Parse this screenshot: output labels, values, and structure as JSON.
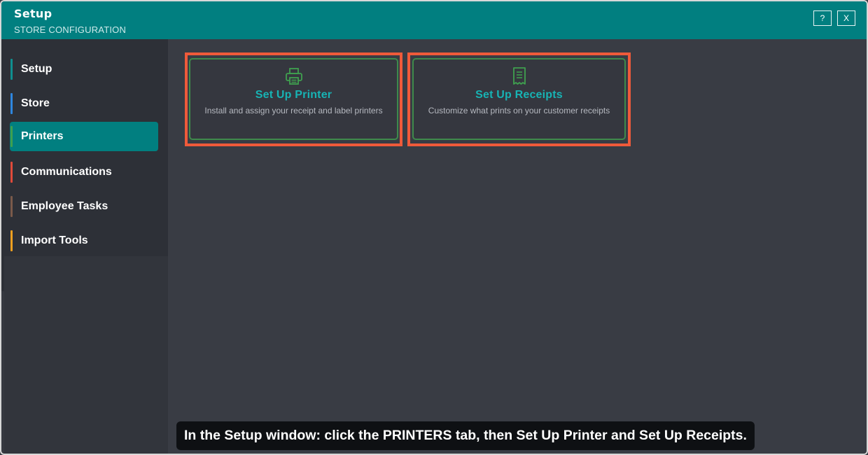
{
  "window": {
    "title": "Setup",
    "subtitle": "STORE CONFIGURATION",
    "help_label": "?",
    "close_label": "X"
  },
  "sidebar": {
    "items": [
      {
        "label": "Setup",
        "accent": "#0f8f8f",
        "active": false
      },
      {
        "label": "Store",
        "accent": "#2e86de",
        "active": false
      },
      {
        "label": "Printers",
        "accent": "#3fa04f",
        "active": true
      },
      {
        "label": "Communications",
        "accent": "#e04a3a",
        "active": false
      },
      {
        "label": "Employee Tasks",
        "accent": "#7a5a4a",
        "active": false
      },
      {
        "label": "Import Tools",
        "accent": "#f0a020",
        "active": false
      }
    ]
  },
  "cards": [
    {
      "title": "Set Up Printer",
      "description": "Install and assign your receipt and label printers",
      "icon": "printer-icon"
    },
    {
      "title": "Set Up Receipts",
      "description": "Customize what prints on your customer receipts",
      "icon": "receipt-icon"
    }
  ],
  "caption": "In the Setup window: click the PRINTERS tab, then Set Up Printer and Set Up Receipts.",
  "colors": {
    "titlebar": "#017f80",
    "card_title": "#17b3b4",
    "icon_green": "#3fa04f",
    "highlight": "#f05a3a"
  }
}
